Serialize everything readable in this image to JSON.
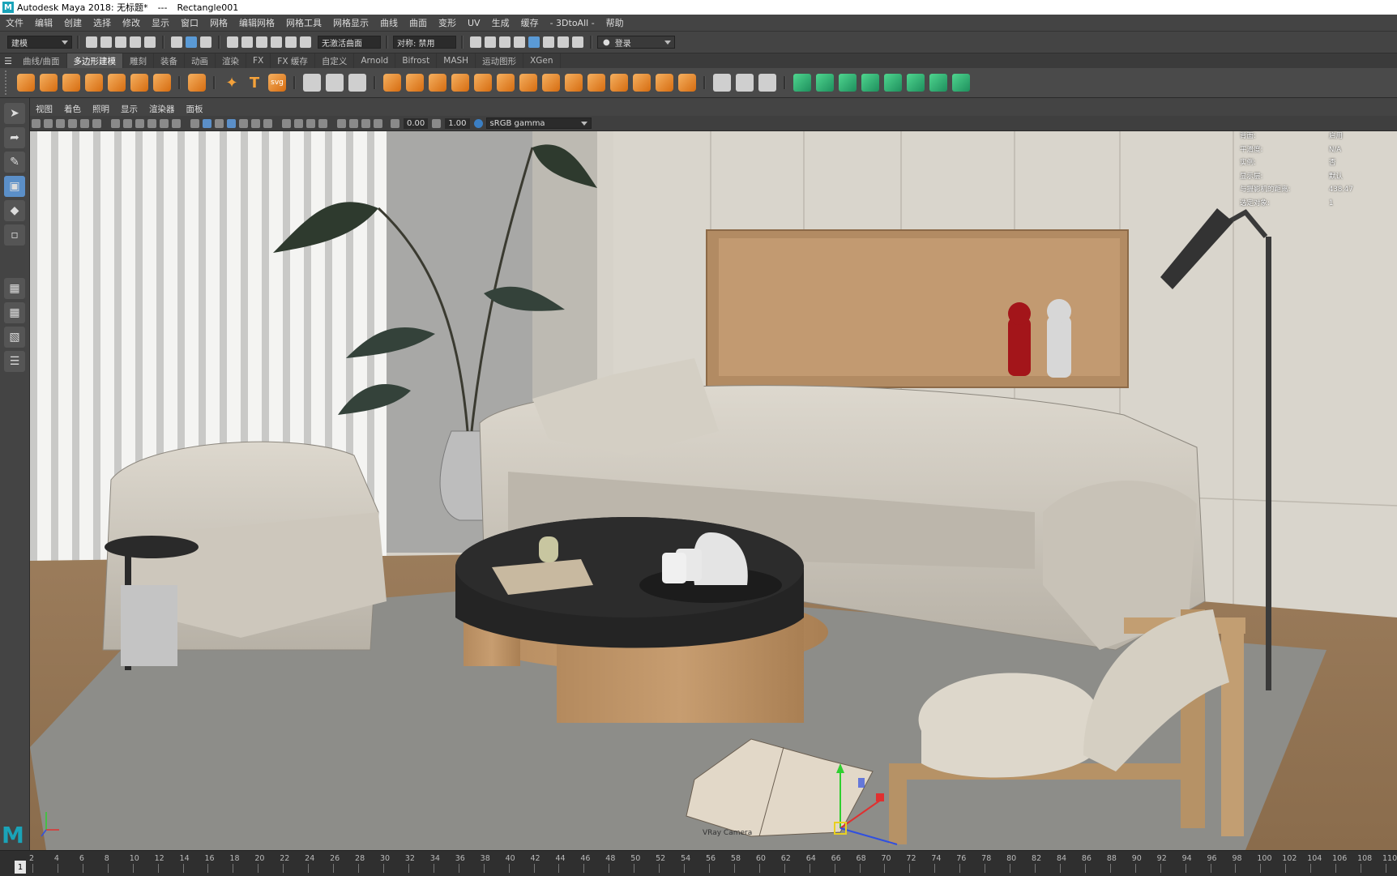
{
  "title": {
    "app": "Autodesk Maya 2018: 无标题*",
    "separator": "---",
    "object": "Rectangle001"
  },
  "menu": [
    "文件",
    "编辑",
    "创建",
    "选择",
    "修改",
    "显示",
    "窗口",
    "网格",
    "编辑网格",
    "网格工具",
    "网格显示",
    "曲线",
    "曲面",
    "变形",
    "UV",
    "生成",
    "缓存",
    "- 3DtoAll -",
    "帮助"
  ],
  "status": {
    "mode": "建模",
    "live_surface": "无激活曲面",
    "symmetry": "对称: 禁用",
    "login": "登录"
  },
  "shelf_tabs": [
    "曲线/曲面",
    "多边形建模",
    "雕刻",
    "装备",
    "动画",
    "渲染",
    "FX",
    "FX 缓存",
    "自定义",
    "Arnold",
    "Bifrost",
    "MASH",
    "运动图形",
    "XGen"
  ],
  "shelf_active": 1,
  "shelf_text_icons": {
    "text": "T",
    "svg": "svg"
  },
  "panel_menu": [
    "视图",
    "着色",
    "照明",
    "显示",
    "渲染器",
    "面板"
  ],
  "panel_toolbar": {
    "exposure": "0.00",
    "gamma": "1.00",
    "colorspace": "sRGB gamma"
  },
  "hud": [
    {
      "k": "背面:",
      "v": "启用"
    },
    {
      "k": "平滑度:",
      "v": "N/A"
    },
    {
      "k": "实例:",
      "v": "否"
    },
    {
      "k": "显示层:",
      "v": "默认"
    },
    {
      "k": "与摄影机的距离:",
      "v": "438.47"
    },
    {
      "k": "选定对象:",
      "v": "1"
    }
  ],
  "timeline": {
    "current": "1",
    "ticks": [
      "2",
      "4",
      "6",
      "8",
      "10",
      "12",
      "14",
      "16",
      "18",
      "20",
      "22",
      "24",
      "26",
      "28",
      "30",
      "32",
      "34",
      "36",
      "38",
      "40",
      "42",
      "44",
      "46",
      "48",
      "50",
      "52",
      "54",
      "56",
      "58",
      "60",
      "62",
      "64",
      "66",
      "68",
      "70",
      "72",
      "74",
      "76",
      "78",
      "80",
      "82",
      "84",
      "86",
      "88",
      "90",
      "92",
      "94",
      "96",
      "98",
      "100",
      "102",
      "104",
      "106",
      "108",
      "110"
    ]
  },
  "logo": "M",
  "book_caption": "VRay Camera"
}
